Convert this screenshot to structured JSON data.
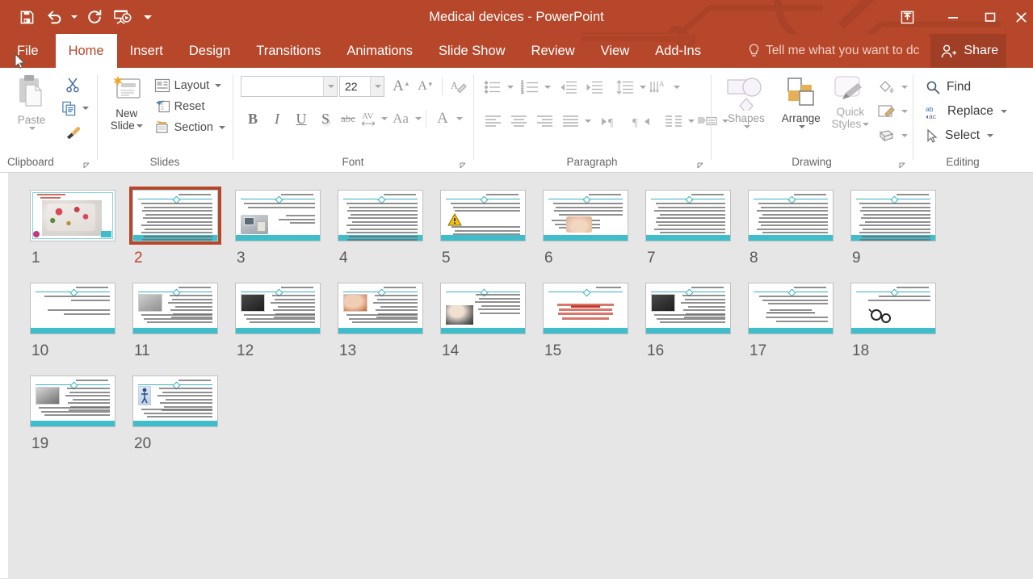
{
  "window": {
    "title": "Medical devices - PowerPoint",
    "quick_access": [
      {
        "name": "save-icon",
        "label": "Save"
      },
      {
        "name": "undo-icon",
        "label": "Undo"
      },
      {
        "name": "redo-icon",
        "label": "Redo"
      },
      {
        "name": "start-presentation-icon",
        "label": "Start From Beginning"
      },
      {
        "name": "customize-qat-icon",
        "label": "Customize Quick Access Toolbar"
      }
    ],
    "controls": [
      {
        "name": "ribbon-display-options-icon",
        "label": "Ribbon Display Options"
      },
      {
        "name": "minimize-icon",
        "label": "Minimize"
      },
      {
        "name": "restore-icon",
        "label": "Restore Down"
      },
      {
        "name": "close-icon",
        "label": "Close"
      }
    ]
  },
  "tabs": [
    {
      "label": "File",
      "active": false
    },
    {
      "label": "Home",
      "active": true
    },
    {
      "label": "Insert",
      "active": false
    },
    {
      "label": "Design",
      "active": false
    },
    {
      "label": "Transitions",
      "active": false
    },
    {
      "label": "Animations",
      "active": false
    },
    {
      "label": "Slide Show",
      "active": false
    },
    {
      "label": "Review",
      "active": false
    },
    {
      "label": "View",
      "active": false
    },
    {
      "label": "Add-Ins",
      "active": false
    }
  ],
  "tellme": {
    "placeholder": "Tell me what you want to dc"
  },
  "share": {
    "label": "Share"
  },
  "ribbon": {
    "clipboard": {
      "group_label": "Clipboard",
      "paste_label": "Paste",
      "cut_label": "Cut",
      "copy_label": "Copy",
      "format_painter_label": "Format Painter"
    },
    "slides": {
      "group_label": "Slides",
      "new_slide_line1": "New",
      "new_slide_line2": "Slide",
      "layout_label": "Layout",
      "reset_label": "Reset",
      "section_label": "Section"
    },
    "font": {
      "group_label": "Font",
      "font_name_value": "",
      "font_size_value": "22",
      "bold_label": "B",
      "italic_label": "I",
      "underline_label": "U",
      "shadow_label": "S",
      "strikethrough_label": "abc",
      "char_spacing_label": "AV",
      "change_case_label": "Aa",
      "font_color_label": "A",
      "increase_size_label": "A",
      "decrease_size_label": "A",
      "clear_formatting_label": "A"
    },
    "paragraph": {
      "group_label": "Paragraph"
    },
    "drawing": {
      "group_label": "Drawing",
      "shapes_label": "Shapes",
      "arrange_label": "Arrange",
      "quick_styles_line1": "Quick",
      "quick_styles_line2": "Styles"
    },
    "editing": {
      "group_label": "Editing",
      "find_label": "Find",
      "replace_label": "Replace",
      "select_label": "Select"
    }
  },
  "slide_sorter": {
    "selected_slide": 2,
    "slides": [
      {
        "number": "1",
        "kind": "picture-full",
        "has_image": true,
        "image": "floral-teacup"
      },
      {
        "number": "2",
        "kind": "text-dense",
        "has_image": false,
        "image": ""
      },
      {
        "number": "3",
        "kind": "text-image-left",
        "has_image": true,
        "image": "computer-equipment"
      },
      {
        "number": "4",
        "kind": "text-dense",
        "has_image": false,
        "image": ""
      },
      {
        "number": "5",
        "kind": "text-warning",
        "has_image": true,
        "image": "warning-triangle"
      },
      {
        "number": "6",
        "kind": "text-image",
        "has_image": true,
        "image": "medical-photo"
      },
      {
        "number": "7",
        "kind": "text-only",
        "has_image": false,
        "image": ""
      },
      {
        "number": "8",
        "kind": "text-only",
        "has_image": false,
        "image": ""
      },
      {
        "number": "9",
        "kind": "text-dense",
        "has_image": false,
        "image": ""
      },
      {
        "number": "10",
        "kind": "text-sparse",
        "has_image": false,
        "image": ""
      },
      {
        "number": "11",
        "kind": "text-image-tl",
        "has_image": true,
        "image": "gray-device"
      },
      {
        "number": "12",
        "kind": "text-image-tl",
        "has_image": true,
        "image": "dark-monitor"
      },
      {
        "number": "13",
        "kind": "text-image-tl",
        "has_image": true,
        "image": "hand-medical"
      },
      {
        "number": "14",
        "kind": "text-image-bl",
        "has_image": true,
        "image": "dark-stethoscope"
      },
      {
        "number": "15",
        "kind": "text-red",
        "has_image": false,
        "image": ""
      },
      {
        "number": "16",
        "kind": "text-image-tl",
        "has_image": true,
        "image": "dark-equipment"
      },
      {
        "number": "17",
        "kind": "text-rule",
        "has_image": false,
        "image": ""
      },
      {
        "number": "18",
        "kind": "text-image-br",
        "has_image": true,
        "image": "glasses-icon"
      },
      {
        "number": "19",
        "kind": "text-image-tl",
        "has_image": true,
        "image": "microscope"
      },
      {
        "number": "20",
        "kind": "text-image-tl",
        "has_image": true,
        "image": "person-figure"
      }
    ]
  },
  "colors": {
    "accent": "#b7472a",
    "share_bg": "#a03f25",
    "canvas": "#e6e6e6",
    "slide_teal": "#3fbdcb"
  }
}
